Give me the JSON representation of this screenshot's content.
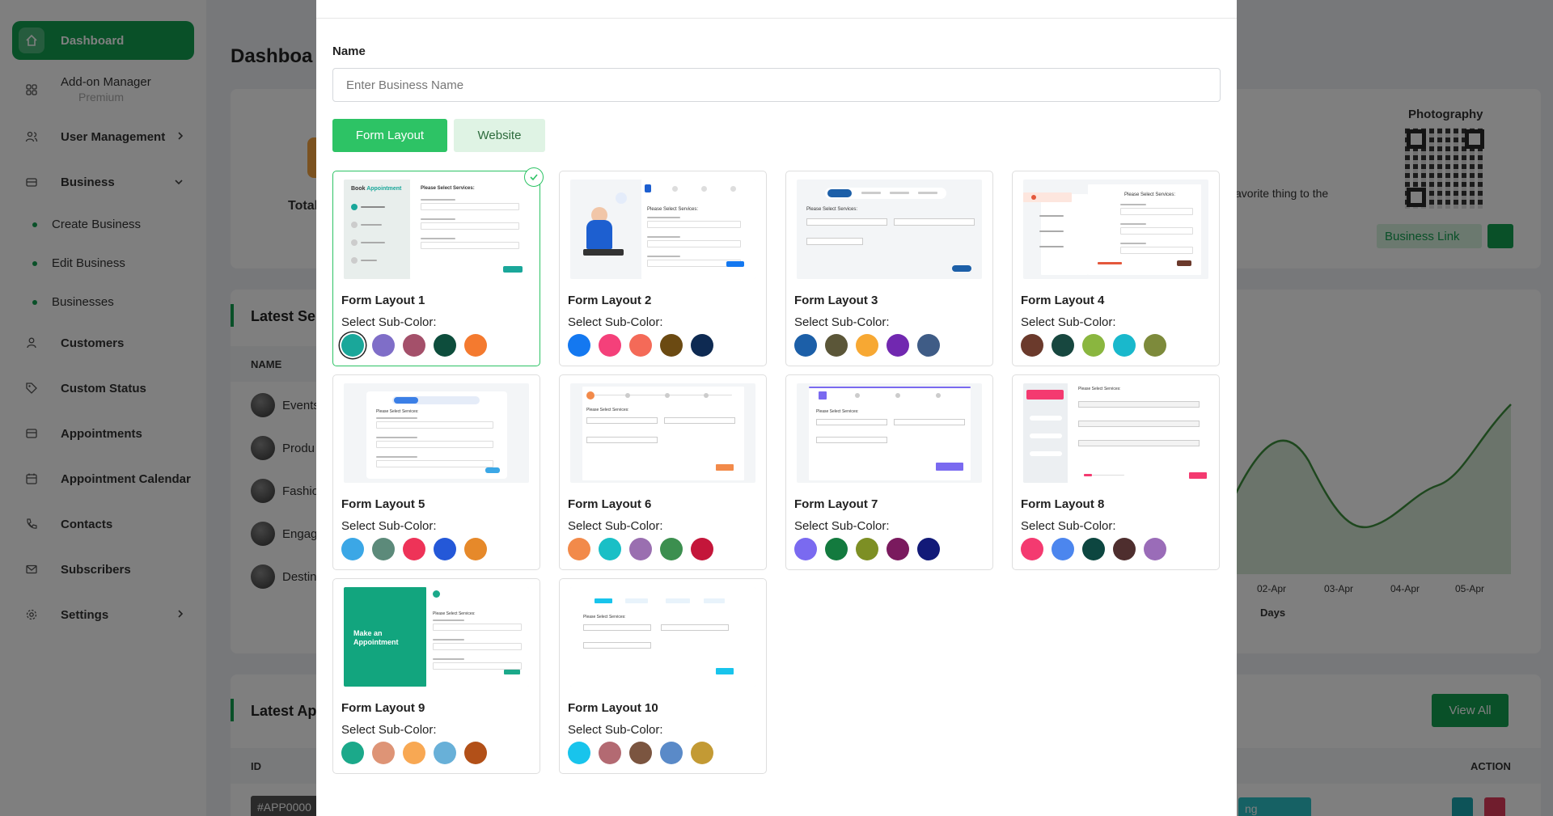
{
  "sidebar": {
    "items": [
      {
        "label": "Dashboard",
        "icon": "home-icon",
        "active": true
      },
      {
        "label": "Add-on Manager",
        "icon": "grid-icon",
        "badge": "Premium"
      },
      {
        "label": "User Management",
        "icon": "users-icon"
      },
      {
        "label": "Business",
        "icon": "briefcase-icon"
      },
      {
        "label": "Customers",
        "icon": "user-icon"
      },
      {
        "label": "Custom Status",
        "icon": "tag-icon"
      },
      {
        "label": "Appointments",
        "icon": "card-icon"
      },
      {
        "label": "Appointment Calendar",
        "icon": "calendar-icon"
      },
      {
        "label": "Contacts",
        "icon": "phone-icon"
      },
      {
        "label": "Subscribers",
        "icon": "mail-icon"
      },
      {
        "label": "Settings",
        "icon": "gear-icon"
      }
    ],
    "business_sub": [
      "Create Business",
      "Edit Business",
      "Businesses"
    ]
  },
  "background": {
    "page_title": "Dashboa",
    "total_label": "Total",
    "latest_services": "Latest Serv",
    "name_col": "NAME",
    "service_rows": [
      "Events",
      "Produ",
      "Fashio",
      "Engage",
      "Destin"
    ],
    "favorite_text": "avorite thing to the",
    "photography": "Photography",
    "business_link": "Business Link",
    "chart_dates": [
      "02-Apr",
      "03-Apr",
      "04-Apr",
      "05-Apr"
    ],
    "chart_xlabel": "Days",
    "latest_appointments": "Latest App",
    "view_all": "View All",
    "id_col": "ID",
    "action_col": "ACTION",
    "appointment_id": "#APP0000",
    "status_fragment": "ng"
  },
  "modal": {
    "name_label": "Name",
    "name_placeholder": "Enter Business Name",
    "name_value": "",
    "tabs": [
      "Form Layout",
      "Website"
    ],
    "sub_color_label": "Select Sub-Color:",
    "layouts": [
      {
        "title": "Form Layout 1",
        "colors": [
          "#1aa79a",
          "#7f6ec8",
          "#a4506a",
          "#0d4d3c",
          "#f47a2f"
        ],
        "selected": true
      },
      {
        "title": "Form Layout 2",
        "colors": [
          "#1478f0",
          "#f4407a",
          "#f46a58",
          "#6b4a12",
          "#0e2a52"
        ]
      },
      {
        "title": "Form Layout 3",
        "colors": [
          "#1c5fa8",
          "#5b5638",
          "#f7a833",
          "#7128b0",
          "#3f5c86"
        ]
      },
      {
        "title": "Form Layout 4",
        "colors": [
          "#6b3a2c",
          "#17473f",
          "#8ab63f",
          "#19b8cc",
          "#7d8a3b"
        ]
      },
      {
        "title": "Form Layout 5",
        "colors": [
          "#3ba7e6",
          "#5c8a7a",
          "#ee3358",
          "#2458d8",
          "#e6892a"
        ]
      },
      {
        "title": "Form Layout 6",
        "colors": [
          "#f28a4a",
          "#19bfc6",
          "#9a6fb0",
          "#3c8f4f",
          "#c4163a"
        ]
      },
      {
        "title": "Form Layout 7",
        "colors": [
          "#7a6af0",
          "#137a3e",
          "#7d8f24",
          "#7a1a5e",
          "#121a78"
        ]
      },
      {
        "title": "Form Layout 8",
        "colors": [
          "#f43a70",
          "#4c86ee",
          "#0d4640",
          "#4e2e2e",
          "#9a6cb8"
        ]
      },
      {
        "title": "Form Layout 9",
        "colors": [
          "#1ba98a",
          "#de9476",
          "#f8a853",
          "#68b0d8",
          "#b25018"
        ]
      },
      {
        "title": "Form Layout 10",
        "colors": [
          "#18c4ec",
          "#b36a72",
          "#7b5540",
          "#5a8ac8",
          "#c39a34"
        ]
      }
    ],
    "thumb_texts": {
      "book": "Book",
      "appointment": "Appointment",
      "please_select": "Please Select Services:",
      "make_an": "Make an",
      "appointment_word": "Appointment"
    }
  }
}
